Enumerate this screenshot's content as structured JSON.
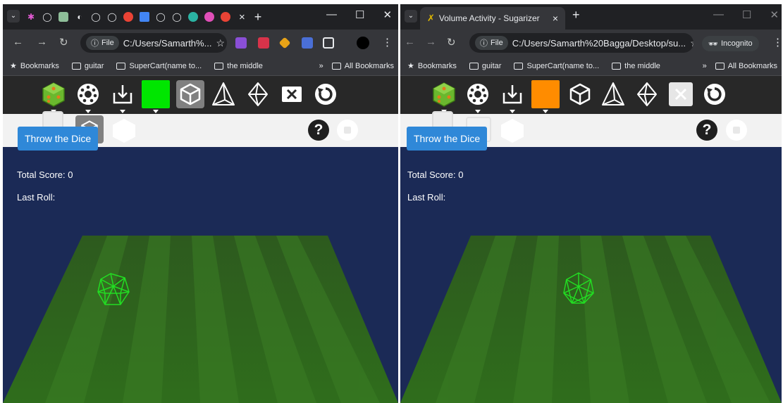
{
  "left_window": {
    "address": {
      "chip": "File",
      "url": "C:/Users/Samarth%..."
    },
    "bookmarks": {
      "items": [
        "Bookmarks",
        "guitar",
        "SuperCart(name to...",
        "the middle"
      ],
      "overflow": "»",
      "all": "All Bookmarks"
    },
    "palette_color": "#00e600",
    "game": {
      "throw_button": "Throw the Dice",
      "total_score": "Total Score: 0",
      "last_roll": "Last Roll:"
    }
  },
  "right_window": {
    "tab": {
      "title": "Volume Activity - Sugarizer"
    },
    "address": {
      "chip": "File",
      "url": "C:/Users/Samarth%20Bagga/Desktop/su...",
      "incognito": "Incognito"
    },
    "bookmarks": {
      "items": [
        "Bookmarks",
        "guitar",
        "SuperCart(name to...",
        "the middle"
      ],
      "overflow": "»",
      "all": "All Bookmarks"
    },
    "palette_color": "#ff8c00",
    "game": {
      "throw_button": "Throw the Dice",
      "total_score": "Total Score: 0",
      "last_roll": "Last Roll:"
    }
  },
  "icons": {
    "toolbar": [
      "dice-icon",
      "ring-icon",
      "import-icon",
      "color-palette-icon",
      "cube-icon",
      "tetrahedron-icon",
      "octahedron-icon",
      "clear-icon",
      "reset-icon"
    ],
    "subbar": [
      "cube-shape-icon",
      "hexagon-shape-icon",
      "help-icon",
      "stop-icon"
    ]
  },
  "colors": {
    "toolbar_bg": "#282828",
    "game_bg": "#1b2a56",
    "board_green": "#2f6a1f",
    "button_blue": "#2f88d8",
    "wire_green": "#22dd22"
  }
}
